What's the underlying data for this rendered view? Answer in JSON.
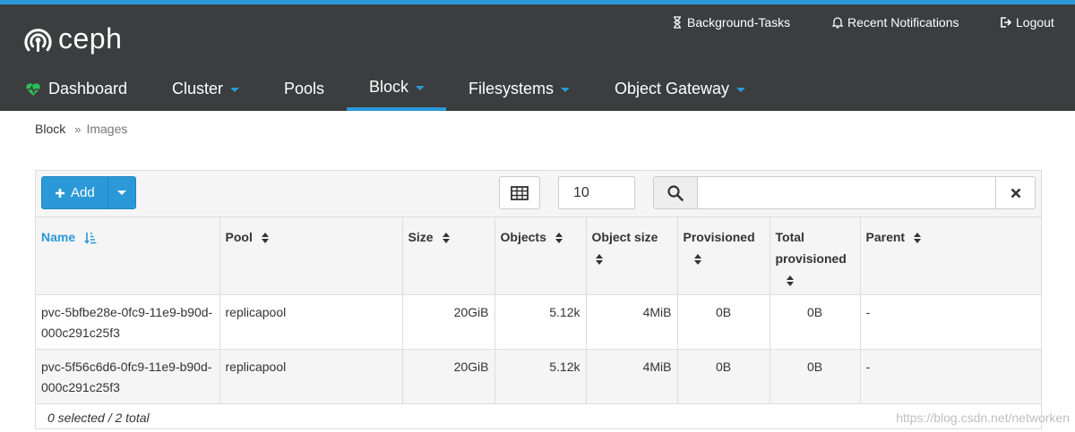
{
  "brand": {
    "name": "ceph"
  },
  "utility": {
    "background_tasks": "Background-Tasks",
    "notifications": "Recent Notifications",
    "logout": "Logout"
  },
  "nav": {
    "dashboard": "Dashboard",
    "cluster": "Cluster",
    "pools": "Pools",
    "block": "Block",
    "filesystems": "Filesystems",
    "object_gateway": "Object Gateway"
  },
  "breadcrumb": {
    "parent": "Block",
    "separator": "»",
    "current": "Images"
  },
  "toolbar": {
    "add_label": "Add",
    "limit_value": "10",
    "search_value": ""
  },
  "table": {
    "columns": [
      "Name",
      "Pool",
      "Size",
      "Objects",
      "Object size",
      "Provisioned",
      "Total provisioned",
      "Parent"
    ],
    "rows": [
      [
        "pvc-5bfbe28e-0fc9-11e9-b90d-000c291c25f3",
        "replicapool",
        "20GiB",
        "5.12k",
        "4MiB",
        "0B",
        "0B",
        "-"
      ],
      [
        "pvc-5f56c6d6-0fc9-11e9-b90d-000c291c25f3",
        "replicapool",
        "20GiB",
        "5.12k",
        "4MiB",
        "0B",
        "0B",
        "-"
      ]
    ]
  },
  "footer": {
    "selection": "0 selected / 2 total"
  },
  "watermark": "https://blog.csdn.net/networken",
  "colors": {
    "accent": "#2b99d8",
    "navbar": "#3c3d3e",
    "heart": "#2bbd5a"
  }
}
